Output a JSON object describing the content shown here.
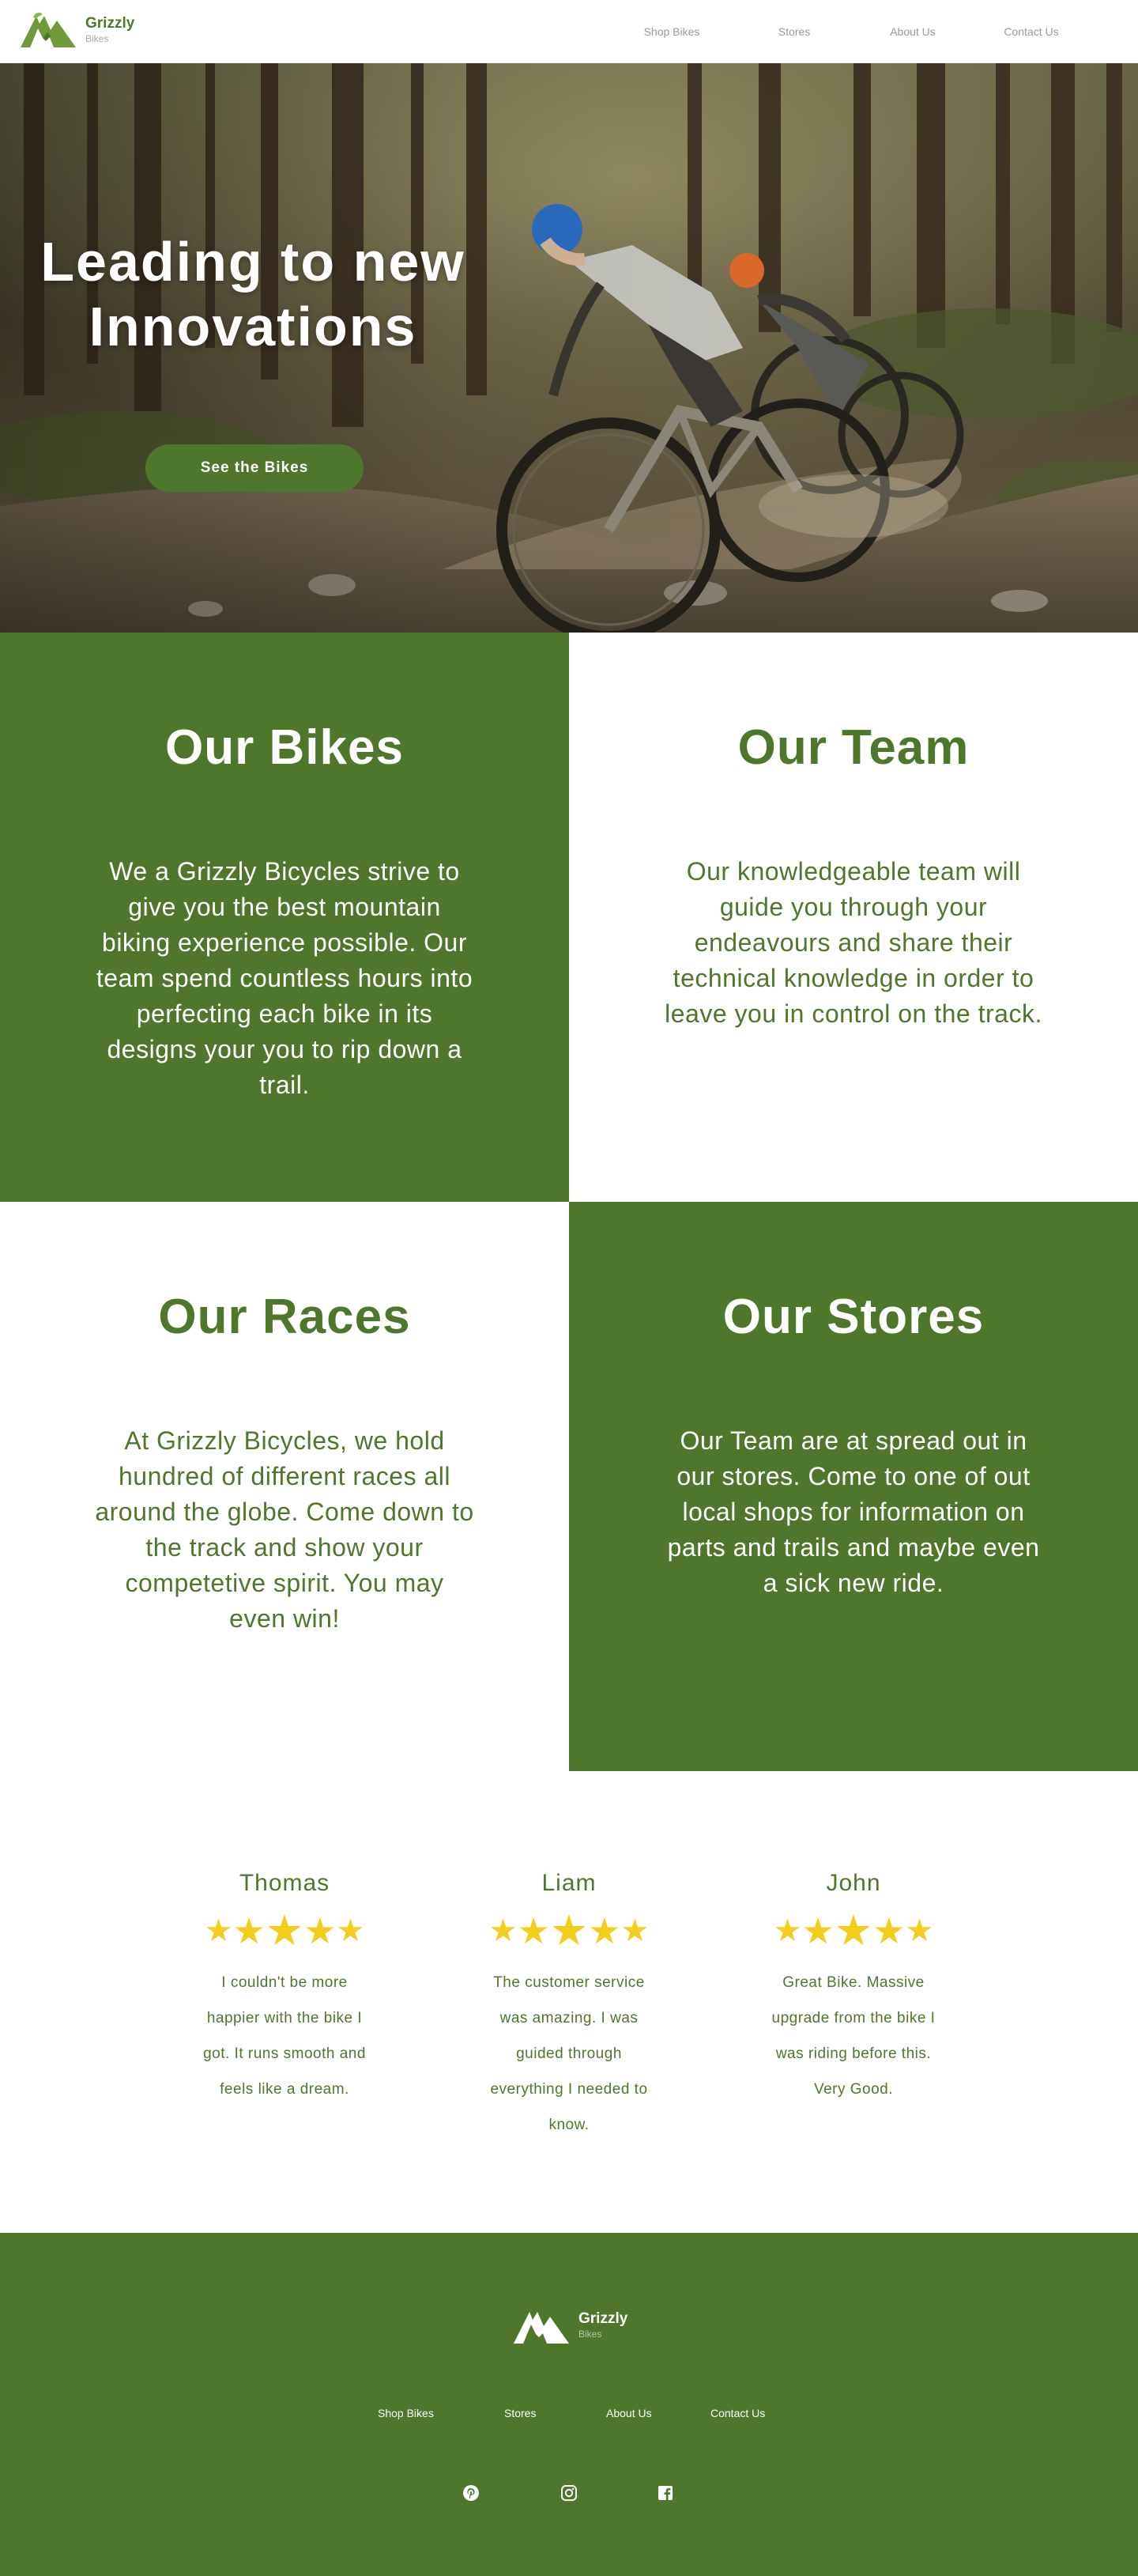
{
  "brand": {
    "name": "Grizzly",
    "sub": "Bikes",
    "accent": "#4e772b",
    "star_color": "#f2cd1b",
    "logo_icon": "grizzly-bear-mountain-logo"
  },
  "nav": {
    "items": [
      "Shop Bikes",
      "Stores",
      "About Us",
      "Contact Us"
    ]
  },
  "hero": {
    "title": "Leading to new Innovations",
    "button_label": "See the Bikes",
    "image": "mountain-bikers-on-forest-trail"
  },
  "features": [
    {
      "title": "Our Bikes",
      "text": "We a Grizzly Bicycles strive to give you the best mountain biking experience possible. Our team spend countless hours into perfecting each bike in its designs your you to rip down a trail."
    },
    {
      "title": "Our Team",
      "text": "Our knowledgeable team will guide you through your endeavours and share their technical knowledge in order to leave you in control on the track."
    },
    {
      "title": "Our Races",
      "text": "At Grizzly Bicycles, we hold hundred of different races all around the globe. Come down to the track and show your competetive spirit. You may even win!"
    },
    {
      "title": "Our Stores",
      "text": "Our Team are at spread out in our stores. Come to one of out local shops for information on parts and trails and maybe even a sick new ride."
    }
  ],
  "reviews": [
    {
      "name": "Thomas",
      "rating": 5,
      "text": "I couldn't be more happier with the bike I got. It runs smooth and feels like a dream."
    },
    {
      "name": "Liam",
      "rating": 5,
      "text": "The customer service was amazing. I was guided through everything I needed to know."
    },
    {
      "name": "John",
      "rating": 5,
      "text": "Great Bike. Massive upgrade from the bike I was riding before this. Very Good."
    }
  ],
  "footer": {
    "name": "Grizzly",
    "sub": "Bikes",
    "links": [
      "Shop Bikes",
      "Stores",
      "About Us",
      "Contact Us"
    ],
    "social_icons": [
      "pinterest-icon",
      "instagram-icon",
      "facebook-icon"
    ]
  }
}
